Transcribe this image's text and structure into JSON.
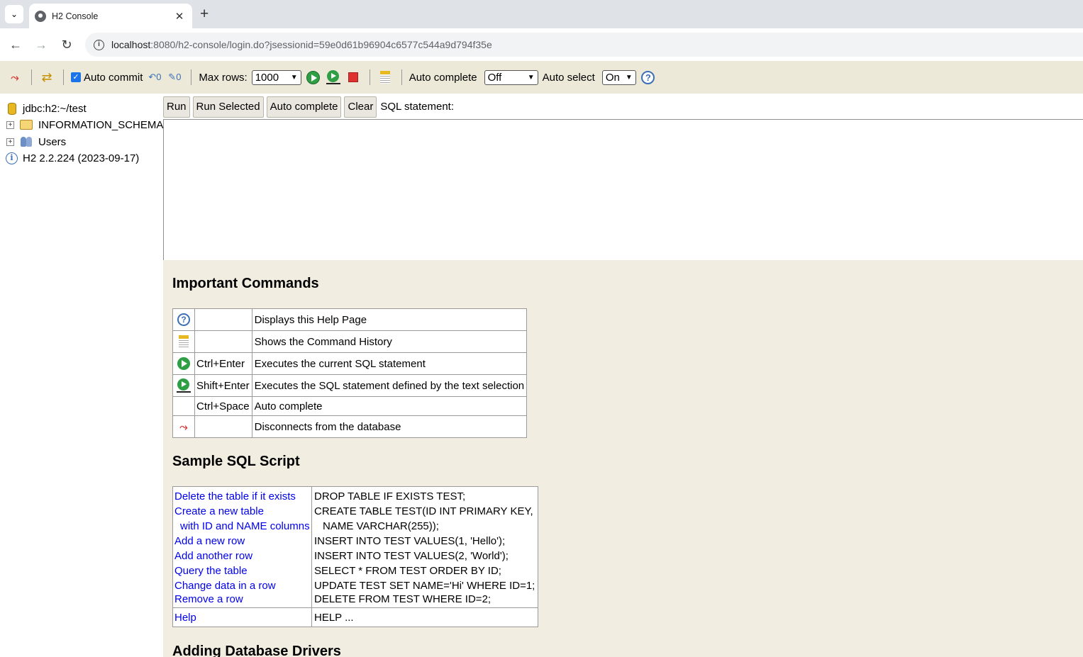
{
  "browser": {
    "tab_title": "H2 Console",
    "close_glyph": "✕",
    "newtab_glyph": "+",
    "url_host": "localhost",
    "url_rest": ":8080/h2-console/login.do?jsessionid=59e0d61b96904c6577c544a9d794f35e"
  },
  "toolbar": {
    "auto_commit_label": "Auto commit",
    "max_rows_label": "Max rows:",
    "max_rows_value": "1000",
    "auto_complete_label": "Auto complete",
    "auto_complete_value": "Off",
    "auto_select_label": "Auto select",
    "auto_select_value": "On"
  },
  "tree": {
    "connection": "jdbc:h2:~/test",
    "items": [
      {
        "label": "INFORMATION_SCHEMA"
      },
      {
        "label": "Users"
      }
    ],
    "version": "H2 2.2.224 (2023-09-17)"
  },
  "query": {
    "run": "Run",
    "run_selected": "Run Selected",
    "auto_complete": "Auto complete",
    "clear": "Clear",
    "sql_label": "SQL statement:"
  },
  "help": {
    "important_title": "Important Commands",
    "commands": [
      {
        "icon": "help-icon",
        "key": "",
        "desc": "Displays this Help Page"
      },
      {
        "icon": "history-icon",
        "key": "",
        "desc": "Shows the Command History"
      },
      {
        "icon": "run-icon",
        "key": "Ctrl+Enter",
        "desc": "Executes the current SQL statement"
      },
      {
        "icon": "run-selected-icon",
        "key": "Shift+Enter",
        "desc": "Executes the SQL statement defined by the text selection"
      },
      {
        "icon": "",
        "key": "Ctrl+Space",
        "desc": "Auto complete"
      },
      {
        "icon": "disconnect-icon",
        "key": "",
        "desc": "Disconnects from the database"
      }
    ],
    "sample_title": "Sample SQL Script",
    "script": [
      {
        "link": "Delete the table if it exists",
        "sql": "DROP TABLE IF EXISTS TEST;"
      },
      {
        "link": "Create a new table",
        "sql": "CREATE TABLE TEST(ID INT PRIMARY KEY,"
      },
      {
        "link": "with ID and NAME columns",
        "sql": "NAME VARCHAR(255));"
      },
      {
        "link": "Add a new row",
        "sql": "INSERT INTO TEST VALUES(1, 'Hello');"
      },
      {
        "link": "Add another row",
        "sql": "INSERT INTO TEST VALUES(2, 'World');"
      },
      {
        "link": "Query the table",
        "sql": "SELECT * FROM TEST ORDER BY ID;"
      },
      {
        "link": "Change data in a row",
        "sql": "UPDATE TEST SET NAME='Hi' WHERE ID=1;"
      },
      {
        "link": "Remove a row",
        "sql": "DELETE FROM TEST WHERE ID=2;"
      }
    ],
    "help_link": "Help",
    "help_sql": "HELP ...",
    "drivers_title": "Adding Database Drivers"
  }
}
